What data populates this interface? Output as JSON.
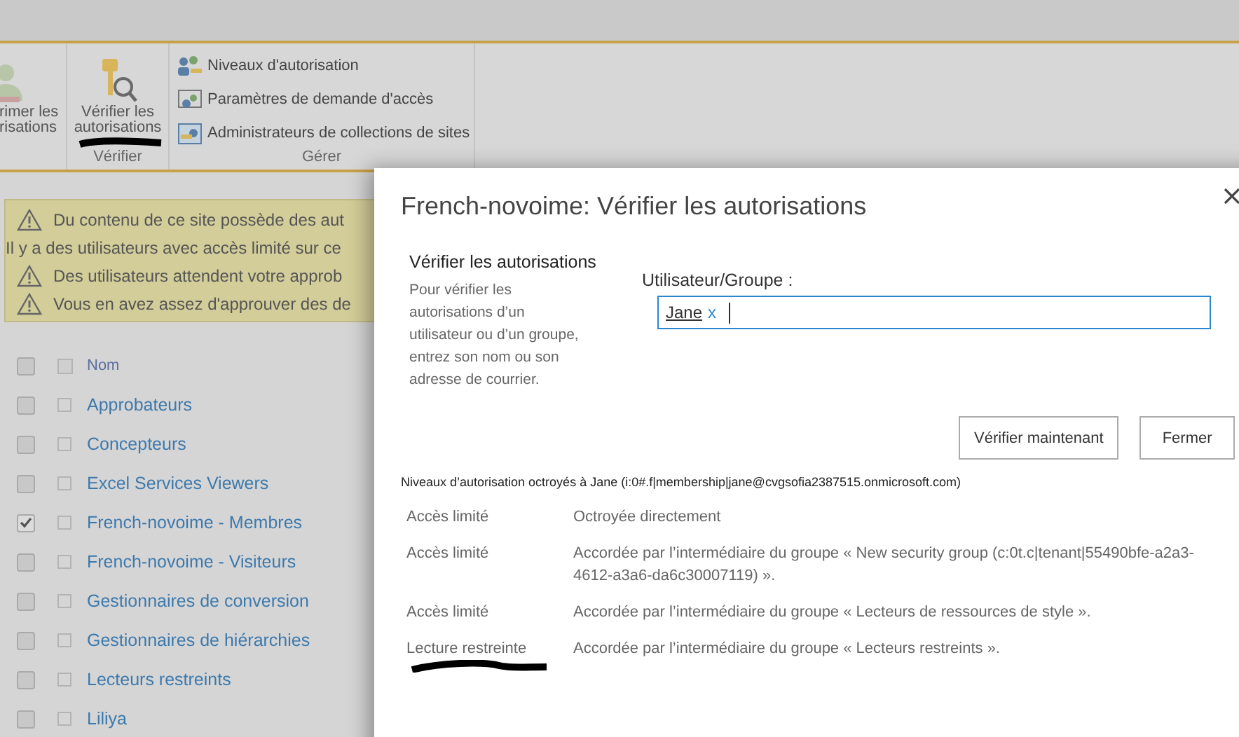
{
  "ribbon": {
    "partial_button": {
      "lines": [
        "rimer les",
        "risations"
      ]
    },
    "check_group": {
      "button_lines": [
        "Vérifier les",
        "autorisations"
      ],
      "label": "Vérifier"
    },
    "manage_group": {
      "items": [
        {
          "label": "Niveaux d'autorisation",
          "kind": "levels"
        },
        {
          "label": "Paramètres de demande d'accès",
          "kind": "request"
        },
        {
          "label": "Administrateurs de collections de sites",
          "kind": "admins"
        }
      ],
      "label": "Gérer"
    }
  },
  "alerts": [
    {
      "kind": "warning",
      "text": "Du contenu de ce site possède des aut"
    },
    {
      "kind": "info",
      "text": "Il y a des utilisateurs avec accès limité sur ce"
    },
    {
      "kind": "warning",
      "text": "Des utilisateurs attendent votre approb"
    },
    {
      "kind": "warning",
      "text": "Vous en avez assez d'approuver des de"
    }
  ],
  "list": {
    "header": "Nom",
    "all_checked": false,
    "header_selected": false,
    "rows": [
      {
        "name": "Approbateurs",
        "checked": false,
        "selected": false
      },
      {
        "name": "Concepteurs",
        "checked": false,
        "selected": false
      },
      {
        "name": "Excel Services Viewers",
        "checked": false,
        "selected": false
      },
      {
        "name": "French-novoime - Membres",
        "checked": true,
        "selected": false
      },
      {
        "name": "French-novoime - Visiteurs",
        "checked": false,
        "selected": false
      },
      {
        "name": "Gestionnaires de conversion",
        "checked": false,
        "selected": false
      },
      {
        "name": "Gestionnaires de hiérarchies",
        "checked": false,
        "selected": false
      },
      {
        "name": "Lecteurs restreints",
        "checked": false,
        "selected": false
      },
      {
        "name": "Liliya",
        "checked": false,
        "selected": false
      }
    ]
  },
  "dialog": {
    "title": "French-novoime: Vérifier les autorisations",
    "section_title": "Vérifier les autorisations",
    "description": "Pour vérifier les autorisations d’un utilisateur ou d’un groupe, entrez son nom ou son adresse de courrier.",
    "field_label": "Utilisateur/Groupe :",
    "field_tokens": [
      {
        "name": "Jane",
        "remove": "x"
      }
    ],
    "buttons": [
      "Vérifier maintenant",
      "Fermer"
    ],
    "results_heading": "Niveaux d’autorisation octroyés à Jane (i:0#.f|membership|jane@cvgsofia2387515.onmicrosoft.com)",
    "results": [
      {
        "level": "Accès limité",
        "source": "Octroyée directement"
      },
      {
        "level": "Accès limité",
        "source": "Accordée par l’intermédiaire du groupe « New security group (c:0t.c|tenant|55490bfe-a2a3-4612-a3a6-da6c30007119) »."
      },
      {
        "level": "Accès limité",
        "source": "Accordée par l’intermédiaire du groupe « Lecteurs de ressources de style »."
      },
      {
        "level": "Lecture restreinte",
        "source": "Accordée par l’intermédiaire du groupe « Lecteurs restreints »."
      }
    ]
  }
}
